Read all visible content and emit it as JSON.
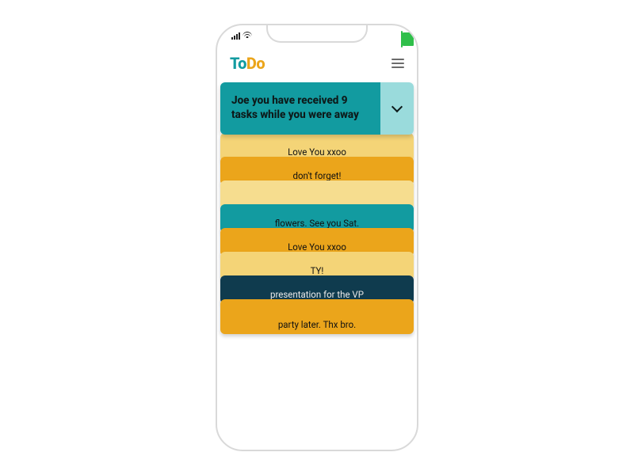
{
  "colors": {
    "teal": "#129ba0",
    "tealLight": "#9adbdc",
    "orange": "#eba51b",
    "orangeDeep": "#d88f12",
    "yellow": "#f4d477",
    "yellowSoft": "#f6dd8f",
    "navy": "#0f3b4e"
  },
  "app": {
    "logo": {
      "to": "To",
      "do": "Do"
    }
  },
  "banner": {
    "text": "Joe you have received 9 tasks while you were away"
  },
  "tasks": [
    {
      "snippet": "Love You xxoo",
      "bg": "#f4d477",
      "dark": false
    },
    {
      "snippet": "don't forget!",
      "bg": "#eba51b",
      "dark": false
    },
    {
      "snippet": "",
      "bg": "#f6dd8f",
      "dark": false
    },
    {
      "snippet": "flowers. See you Sat.",
      "bg": "#129ba0",
      "dark": false
    },
    {
      "snippet": "Love You xxoo",
      "bg": "#eba51b",
      "dark": false
    },
    {
      "snippet": "TY!",
      "bg": "#f4d477",
      "dark": false
    },
    {
      "snippet": "presentation for the VP",
      "bg": "#0f3b4e",
      "dark": true
    },
    {
      "snippet": "party later. Thx bro.",
      "bg": "#eba51b",
      "dark": false
    }
  ]
}
